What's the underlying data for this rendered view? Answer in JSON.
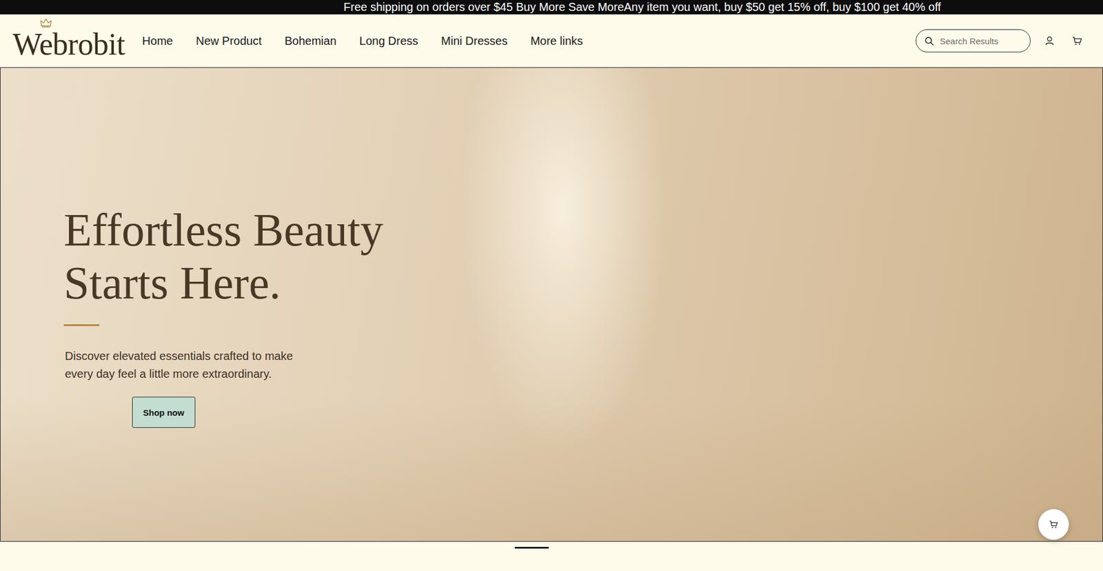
{
  "announcement": "Free shipping on orders over $45 Buy More Save MoreAny item you want, buy $50 get 15% off, buy $100 get 40% off",
  "logo": {
    "text": "Webrobit"
  },
  "nav": [
    {
      "label": "Home"
    },
    {
      "label": "New Product"
    },
    {
      "label": "Bohemian"
    },
    {
      "label": "Long Dress"
    },
    {
      "label": "Mini Dresses"
    },
    {
      "label": "More links"
    }
  ],
  "search": {
    "placeholder": "Search Results"
  },
  "hero": {
    "title_lines": [
      "Effortless Beauty",
      "Starts Here."
    ],
    "subtitle_lines": [
      "Discover elevated essentials crafted to make",
      "every day feel a little more extraordinary."
    ],
    "button": "Shop now"
  },
  "slides": [
    {
      "selected": true
    }
  ]
}
